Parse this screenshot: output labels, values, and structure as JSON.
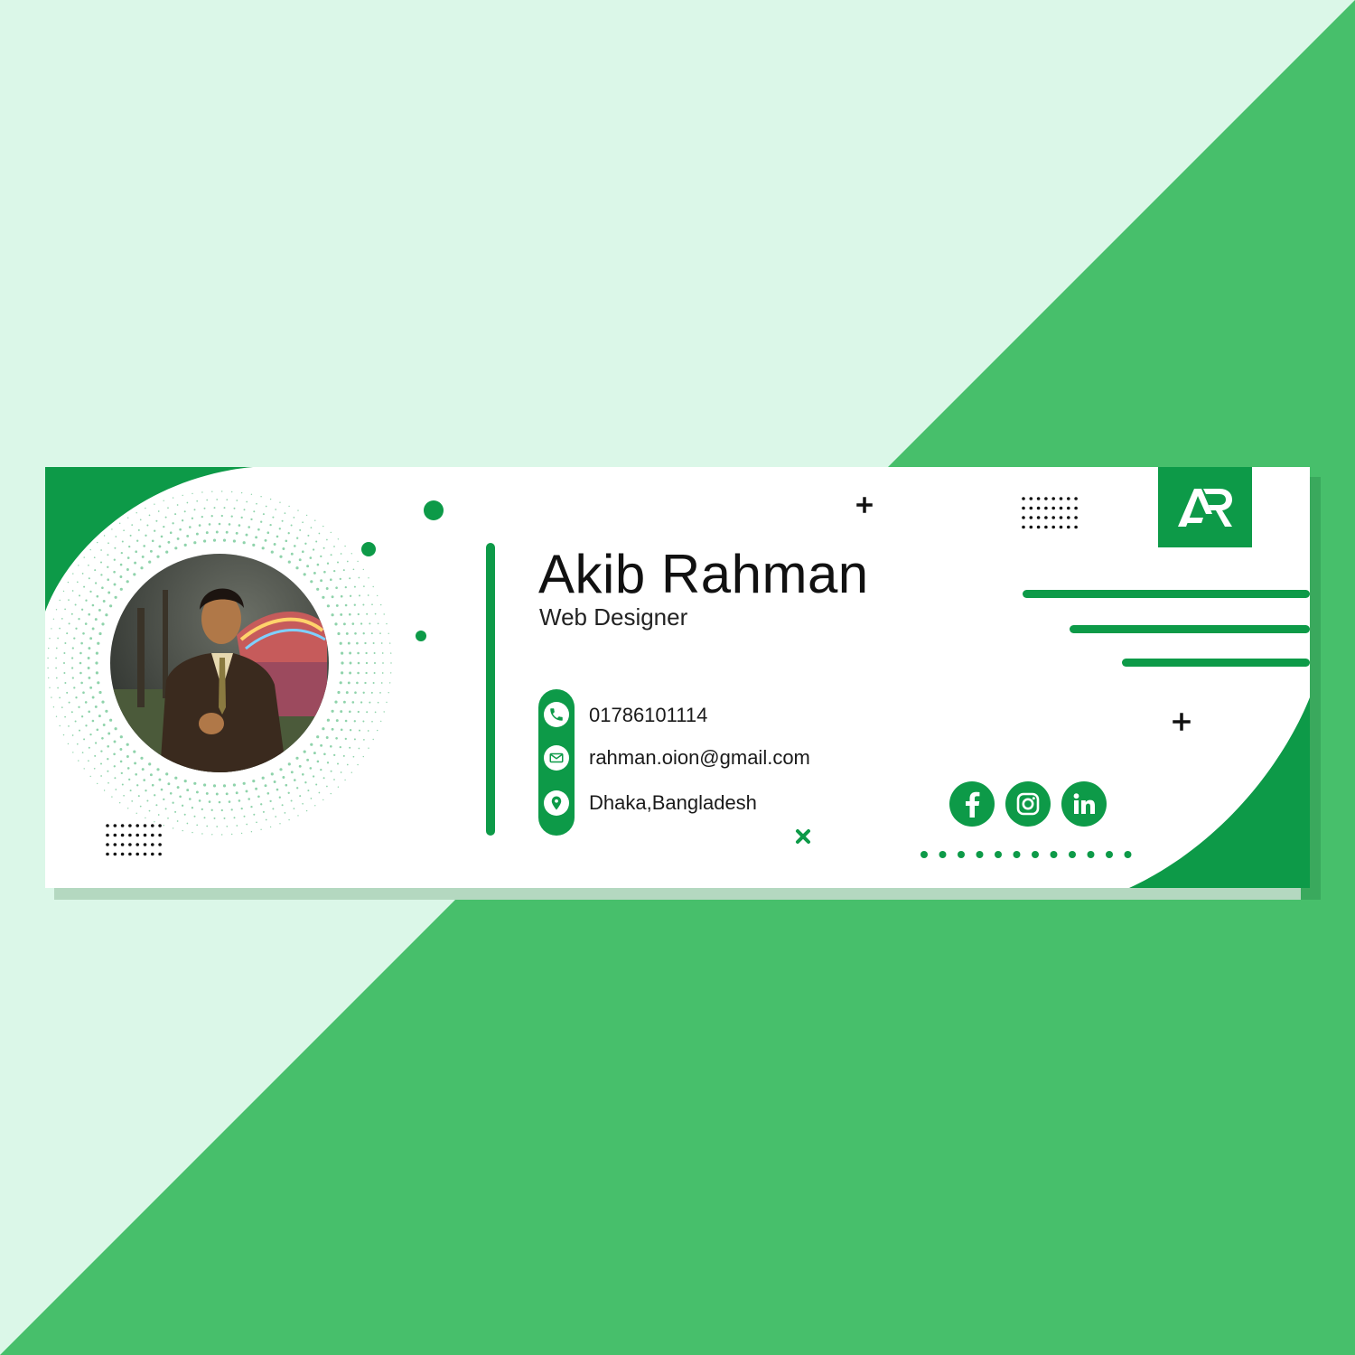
{
  "profile": {
    "name": "Akib Rahman",
    "title": "Web Designer"
  },
  "contacts": [
    {
      "icon": "phone-icon",
      "text": "01786101114"
    },
    {
      "icon": "mail-icon",
      "text": "rahman.oion@gmail.com"
    },
    {
      "icon": "location-pin-icon",
      "text": "Dhaka,Bangladesh"
    }
  ],
  "logo": {
    "text": "AR"
  },
  "social": [
    {
      "icon": "facebook-icon"
    },
    {
      "icon": "instagram-icon"
    },
    {
      "icon": "linkedin-icon"
    }
  ],
  "colors": {
    "brand_green": "#0d9a48",
    "background_green": "#47bf6b",
    "background_mint": "#dbf7e8"
  }
}
